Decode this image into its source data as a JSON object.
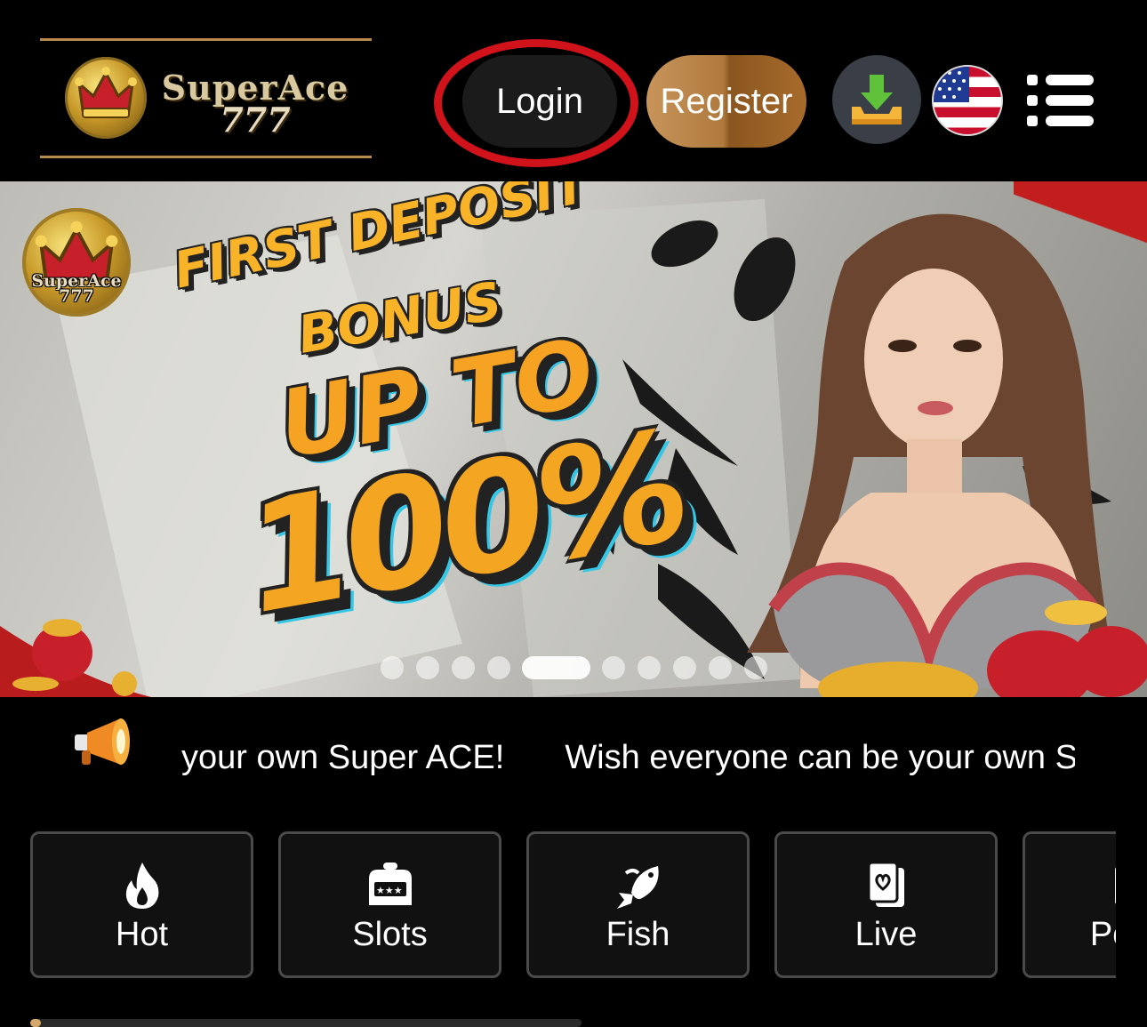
{
  "header": {
    "logo": {
      "line1": "SuperAce",
      "line2": "777"
    },
    "login_label": "Login",
    "register_label": "Register",
    "download_icon": "download-icon",
    "language_icon": "us-flag-icon",
    "menu_icon": "menu-icon"
  },
  "banner": {
    "logo": {
      "line1": "SuperAce",
      "line2": "777"
    },
    "promo": {
      "line1": "FIRST DEPOSIT",
      "line2": "BONUS",
      "line3": "UP TO",
      "line4": "100%"
    },
    "carousel": {
      "total_slides": 10,
      "active_index": 4
    }
  },
  "announcement": {
    "icon": "megaphone-icon",
    "segments": [
      "your own Super ACE!",
      "Wish everyone can be your own Super ACE!"
    ]
  },
  "categories": [
    {
      "label": "Hot",
      "icon": "flame-icon"
    },
    {
      "label": "Slots",
      "icon": "slot-machine-icon"
    },
    {
      "label": "Fish",
      "icon": "fish-icon"
    },
    {
      "label": "Live",
      "icon": "playing-card-icon"
    },
    {
      "label": "Poker",
      "icon": "poker-icon"
    }
  ],
  "colors": {
    "background": "#000000",
    "accent_gold": "#b98a4e",
    "highlight_red": "#d0121b",
    "promo_orange": "#f6a323"
  }
}
